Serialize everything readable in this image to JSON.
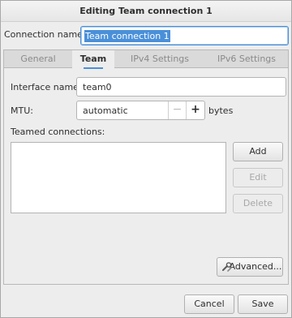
{
  "window": {
    "title": "Editing Team connection 1"
  },
  "connection": {
    "label": "Connection name:",
    "value": "Team connection 1"
  },
  "tabs": [
    {
      "label": "General",
      "active": false
    },
    {
      "label": "Team",
      "active": true
    },
    {
      "label": "IPv4 Settings",
      "active": false
    },
    {
      "label": "IPv6 Settings",
      "active": false
    }
  ],
  "team": {
    "interface_label": "Interface name:",
    "interface_value": "team0",
    "mtu_label": "MTU:",
    "mtu_value": "automatic",
    "mtu_minus": "−",
    "mtu_plus": "+",
    "mtu_unit": "bytes",
    "teamed_label": "Teamed connections:",
    "add_label": "Add",
    "edit_label": "Edit",
    "delete_label": "Delete",
    "advanced_label": "Advanced..."
  },
  "footer": {
    "cancel_label": "Cancel",
    "save_label": "Save"
  },
  "colors": {
    "accent": "#4a90d9",
    "window_bg": "#ededed"
  },
  "icons": {
    "advanced": "tools-icon"
  }
}
